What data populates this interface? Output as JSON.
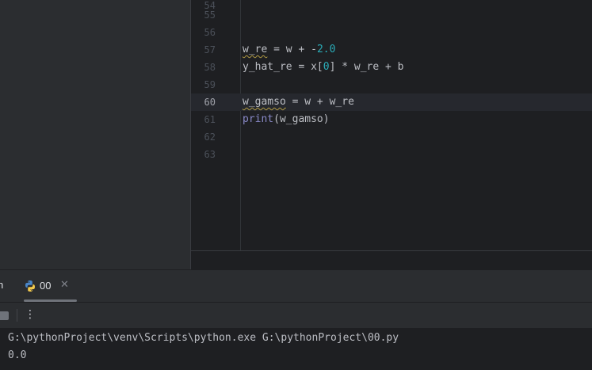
{
  "editor": {
    "lines": [
      {
        "number": "54"
      },
      {
        "number": "55"
      },
      {
        "number": "56"
      },
      {
        "number": "57",
        "code": {
          "var": "w_re",
          "op": " = w + -",
          "num": "2.0"
        }
      },
      {
        "number": "58",
        "code": {
          "a": "y_hat_re = x[",
          "num": "0",
          "b": "] * w_re + b"
        }
      },
      {
        "number": "59"
      },
      {
        "number": "60",
        "code": {
          "var": "w_gamso",
          "rest": " = w + w_re"
        }
      },
      {
        "number": "61",
        "code": {
          "fn": "print",
          "rest": "(w_gamso)"
        }
      },
      {
        "number": "62"
      },
      {
        "number": "63"
      }
    ]
  },
  "toolwindow": {
    "cut_tab_text": "n",
    "run_tab": {
      "label": "00",
      "icon": "python-icon",
      "close_icon": "close-icon"
    },
    "toolbar": {
      "stop_icon": "stop-icon",
      "more_icon": "more-vertical-icon",
      "more_glyph": "⋮"
    }
  },
  "console": {
    "lines": [
      "G:\\pythonProject\\venv\\Scripts\\python.exe G:\\pythonProject\\00.py",
      "0.0"
    ]
  },
  "colors": {
    "background": "#1e1f22",
    "panel": "#2b2d30",
    "text": "#bcbec4",
    "number": "#2aacb8",
    "builtin": "#8888c6",
    "warning_underline": "#b09a43"
  }
}
